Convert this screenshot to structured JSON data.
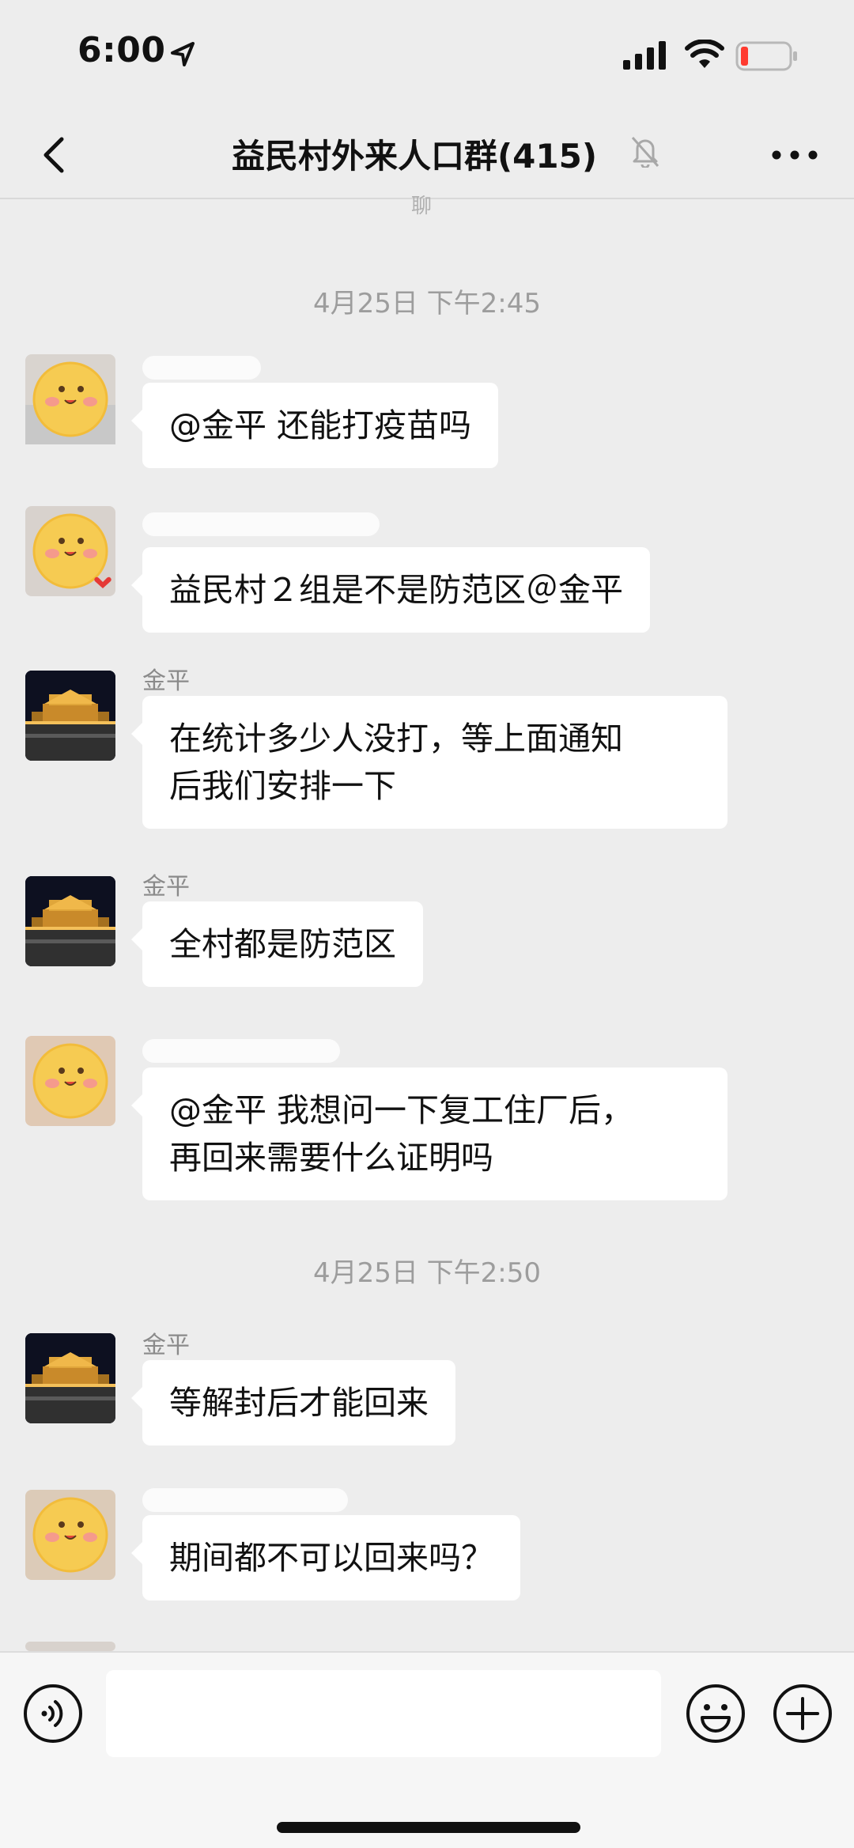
{
  "status_bar": {
    "time": "6:00",
    "battery_color": "#ff3b30"
  },
  "header": {
    "title": "益民村外来人口群",
    "member_count": "(415)",
    "icons": [
      "back-arrow-icon",
      "mute-bell-icon",
      "more-dots-icon"
    ]
  },
  "faded_top_text": "聊",
  "chat": {
    "dividers": [
      {
        "text": "4月25日 下午2:45"
      },
      {
        "text": "4月25日 下午2:50"
      }
    ],
    "messages": [
      {
        "sender": "",
        "avatar": "sun-sticker-avatar",
        "text": "@金平 还能打疫苗吗"
      },
      {
        "sender": "",
        "avatar": "sun-sticker-avatar",
        "text": "益民村２组是不是防范区＠金平"
      },
      {
        "sender": "金平",
        "avatar": "night-building-avatar",
        "text_lines": [
          "在统计多少人没打，等上面通知",
          "后我们安排一下"
        ]
      },
      {
        "sender": "金平",
        "avatar": "night-building-avatar",
        "text": "全村都是防范区"
      },
      {
        "sender": "",
        "avatar": "sun-sticker-avatar",
        "text_lines": [
          "@金平 我想问一下复工住厂后，",
          "再回来需要什么证明吗"
        ]
      },
      {
        "sender": "金平",
        "avatar": "night-building-avatar",
        "text": "等解封后才能回来"
      },
      {
        "sender": "",
        "avatar": "sun-sticker-avatar",
        "text": "期间都不可以回来吗？"
      }
    ]
  },
  "input_bar": {
    "icons": [
      "voice-icon",
      "emoji-icon",
      "plus-icon"
    ],
    "placeholder": ""
  },
  "colors": {
    "background": "#ededed",
    "bubble": "#ffffff",
    "divider_text": "#9d9d9d",
    "sender_text": "#8a8a8a"
  }
}
